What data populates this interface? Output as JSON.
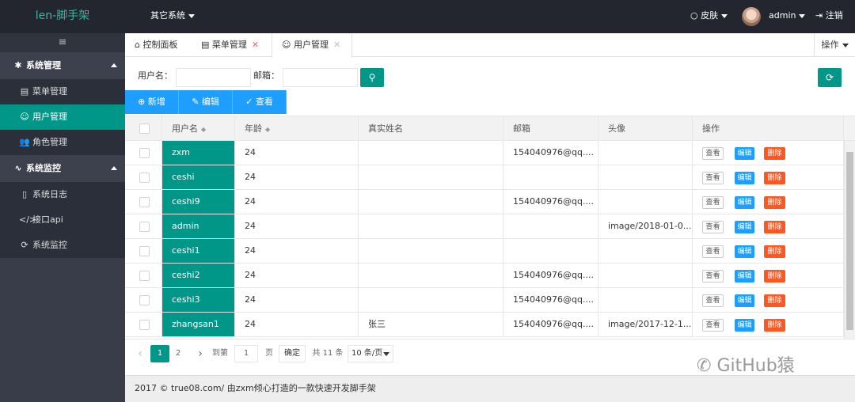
{
  "header": {
    "logo": "len-脚手架",
    "other_systems": "其它系统",
    "skin": "○ 皮肤",
    "user": "admin",
    "logout": "⇥ 注销"
  },
  "sidebar": {
    "toggle": "≡",
    "groups": [
      {
        "label": "系统管理",
        "icon": "gear-icon",
        "items": [
          {
            "label": "菜单管理",
            "icon": "calendar-icon"
          },
          {
            "label": "用户管理",
            "icon": "smile-icon"
          },
          {
            "label": "角色管理",
            "icon": "users-icon"
          }
        ]
      },
      {
        "label": "系统监控",
        "icon": "pulse-icon",
        "items": [
          {
            "label": "系统日志",
            "icon": "doc-icon"
          },
          {
            "label": "接口api",
            "icon": "code-icon"
          },
          {
            "label": "系统监控",
            "icon": "refresh-icon"
          }
        ]
      }
    ]
  },
  "tabs": [
    {
      "label": "控制面板",
      "icon": "home-icon"
    },
    {
      "label": "菜单管理",
      "icon": "calendar-icon",
      "close": "✕"
    },
    {
      "label": "用户管理",
      "icon": "smile-icon",
      "close": "✕"
    }
  ],
  "tab_ops": "操作",
  "search": {
    "username_label": "用户名：",
    "email_label": "邮箱：",
    "username_value": "",
    "email_value": ""
  },
  "toolbar": {
    "add": "新增",
    "edit": "编辑",
    "view": "查看"
  },
  "table": {
    "columns": [
      "用户名",
      "年龄",
      "真实姓名",
      "邮箱",
      "头像",
      "操作"
    ],
    "rows": [
      {
        "username": "zxm",
        "age": "24",
        "realname": "",
        "email": "154040976@qq....",
        "avatar": ""
      },
      {
        "username": "ceshi",
        "age": "24",
        "realname": "",
        "email": "",
        "avatar": ""
      },
      {
        "username": "ceshi9",
        "age": "24",
        "realname": "",
        "email": "154040976@qq....",
        "avatar": ""
      },
      {
        "username": "admin",
        "age": "24",
        "realname": "",
        "email": "",
        "avatar": "image/2018-01-0..."
      },
      {
        "username": "ceshi1",
        "age": "24",
        "realname": "",
        "email": "",
        "avatar": ""
      },
      {
        "username": "ceshi2",
        "age": "24",
        "realname": "",
        "email": "154040976@qq....",
        "avatar": ""
      },
      {
        "username": "ceshi3",
        "age": "24",
        "realname": "",
        "email": "154040976@qq....",
        "avatar": ""
      },
      {
        "username": "zhangsan1",
        "age": "24",
        "realname": "张三",
        "email": "154040976@qq....",
        "avatar": "image/2017-12-1..."
      }
    ],
    "actions": {
      "view": "查看",
      "edit": "编辑",
      "delete": "删除"
    }
  },
  "pager": {
    "prev": "‹",
    "current": "1",
    "page2": "2",
    "next": "›",
    "goto_label": "到第",
    "goto_value": "1",
    "page_unit": "页",
    "confirm": "确定",
    "total": "共 11 条",
    "page_size": "10 条/页"
  },
  "footer": "2017 © true08.com/ 由zxm倾心打造的一款快速开发脚手架",
  "watermark": "GitHub猿",
  "colors": {
    "primary": "#009688",
    "blue": "#1e9fff",
    "danger": "#ff5722",
    "dark": "#393d49"
  }
}
